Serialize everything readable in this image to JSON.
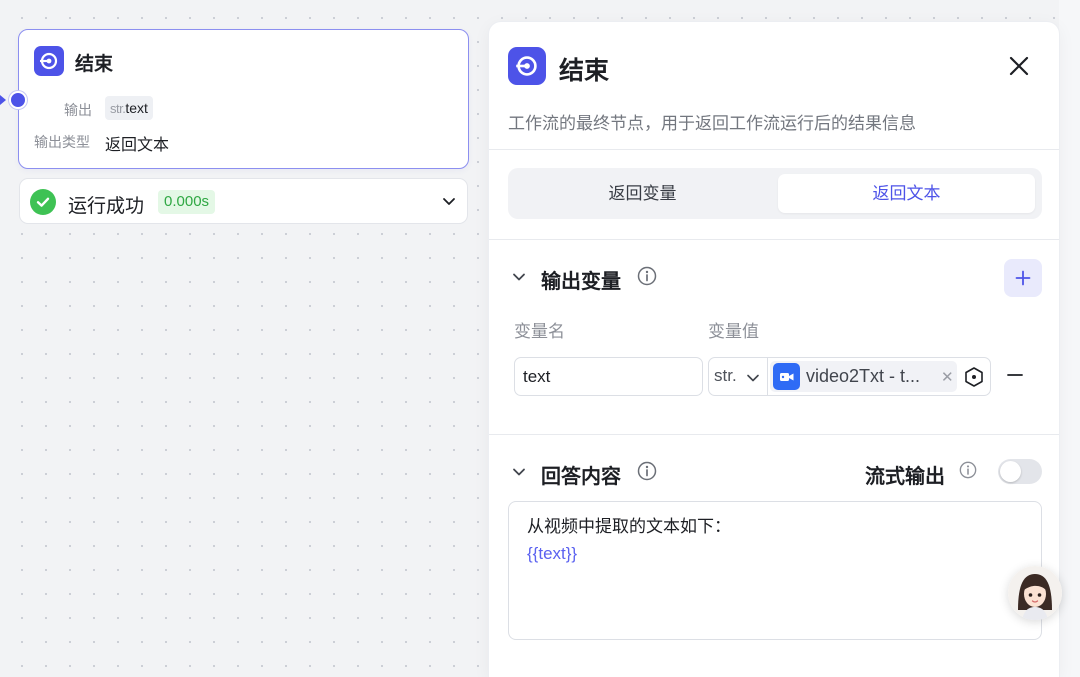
{
  "canvas_node": {
    "title": "结束",
    "output_label": "输出",
    "output_type_prefix": "str.",
    "output_type_name": "text",
    "output_kind_label": "输出类型",
    "output_kind_value": "返回文本"
  },
  "run_status": {
    "text": "运行成功",
    "time": "0.000s",
    "color": "#3ec254"
  },
  "panel": {
    "title": "结束",
    "description": "工作流的最终节点，用于返回工作流运行后的结果信息",
    "tabs": [
      {
        "label": "返回变量",
        "active": false
      },
      {
        "label": "返回文本",
        "active": true
      }
    ],
    "output_section": {
      "title": "输出变量",
      "col_name": "变量名",
      "col_value": "变量值",
      "variable": {
        "name": "text",
        "type": "str.",
        "ref": "video2Txt - t..."
      }
    },
    "answer_section": {
      "title": "回答内容",
      "stream_label": "流式输出",
      "stream_enabled": false,
      "content_line1": "从视频中提取的文本如下：",
      "content_line2": "{{text}}"
    }
  },
  "accent_color": "#4d53e8"
}
